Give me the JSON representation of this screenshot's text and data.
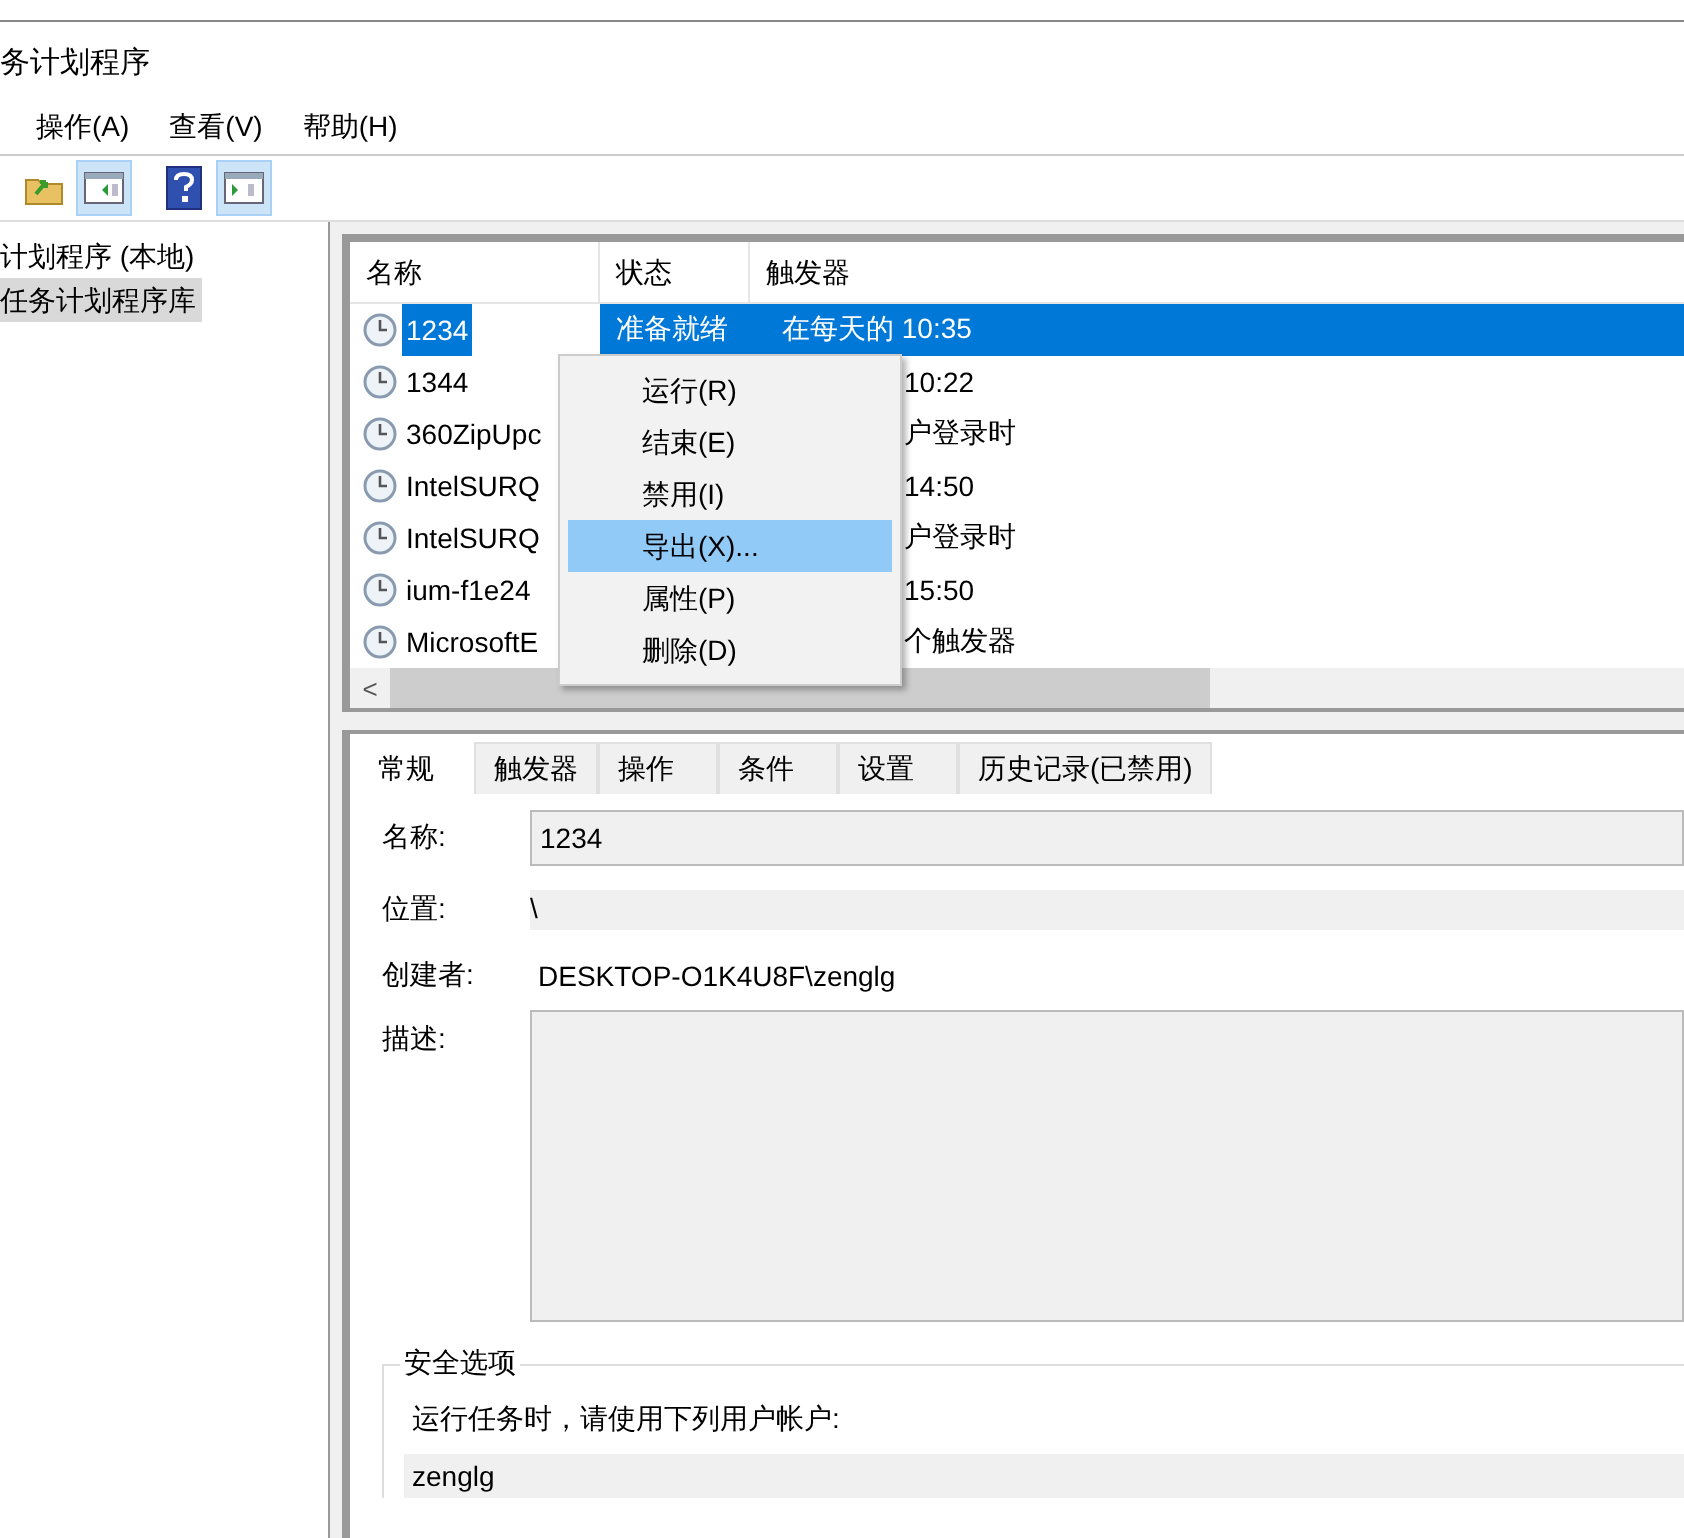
{
  "window": {
    "title": "务计划程序"
  },
  "menu_bar": [
    "操作(A)",
    "查看(V)",
    "帮助(H)"
  ],
  "toolbar": [
    {
      "kind": "folder-up",
      "pressed": false
    },
    {
      "kind": "pane-left",
      "pressed": true
    },
    {
      "kind": "help",
      "pressed": false
    },
    {
      "kind": "pane-right",
      "pressed": true
    }
  ],
  "tree": {
    "items": [
      {
        "label": "计划程序 (本地)",
        "selected": false
      },
      {
        "label": "任务计划程序库",
        "selected": true
      }
    ]
  },
  "task_table": {
    "columns": [
      "名称",
      "状态",
      "触发器"
    ],
    "rows": [
      {
        "name": "1234",
        "status": "准备就绪",
        "trigger": "在每天的 10:35",
        "selected": true
      },
      {
        "name": "1344",
        "trigger": "10:22",
        "selected": false
      },
      {
        "name": "360ZipUpc",
        "trigger": "户登录时",
        "selected": false
      },
      {
        "name": "IntelSURQ",
        "trigger": "14:50",
        "selected": false
      },
      {
        "name": "IntelSURQ",
        "trigger": "户登录时",
        "selected": false
      },
      {
        "name": "ium-f1e24",
        "trigger": "15:50",
        "selected": false
      },
      {
        "name": "MicrosoftE",
        "trigger": "个触发器",
        "selected": false
      }
    ],
    "scroll_left": "<"
  },
  "context_menu": [
    {
      "label": "运行(R)",
      "highlighted": false
    },
    {
      "label": "结束(E)",
      "highlighted": false
    },
    {
      "label": "禁用(I)",
      "highlighted": false
    },
    {
      "label": "导出(X)...",
      "highlighted": true
    },
    {
      "label": "属性(P)",
      "highlighted": false
    },
    {
      "label": "删除(D)",
      "highlighted": false
    }
  ],
  "detail_tabs": [
    {
      "label": "常规",
      "selected": true
    },
    {
      "label": "触发器",
      "selected": false
    },
    {
      "label": "操作",
      "selected": false
    },
    {
      "label": "条件",
      "selected": false
    },
    {
      "label": "设置",
      "selected": false
    },
    {
      "label": "历史记录(已禁用)",
      "selected": false
    }
  ],
  "general": {
    "name_label": "名称:",
    "name_value": "1234",
    "location_label": "位置:",
    "location_value": "\\",
    "author_label": "创建者:",
    "author_value": "DESKTOP-O1K4U8F\\zenglg",
    "description_label": "描述:",
    "security": {
      "title": "安全选项",
      "prompt": "运行任务时，请使用下列用户帐户:",
      "user": "zenglg"
    }
  }
}
